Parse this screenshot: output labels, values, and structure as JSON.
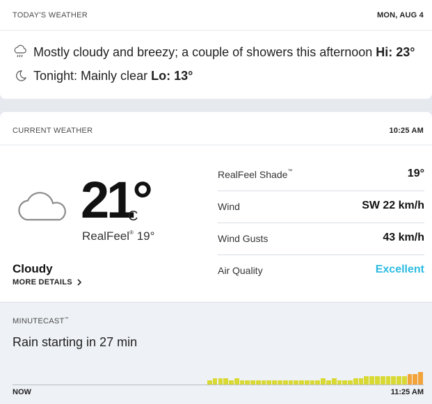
{
  "today": {
    "title": "TODAY'S WEATHER",
    "date": "MON, AUG 4",
    "day_phrase": "Mostly cloudy and breezy; a couple of showers this afternoon",
    "day_hi": "Hi: 23°",
    "night_phrase": "Tonight: Mainly clear",
    "night_lo": "Lo: 13°"
  },
  "current": {
    "title": "CURRENT WEATHER",
    "time": "10:25 AM",
    "temp": "21°",
    "unit": "C",
    "realfeel_label": "RealFeel",
    "realfeel_value": "19°",
    "phrase": "Cloudy",
    "more_details": "MORE DETAILS",
    "details": [
      {
        "label": "RealFeel Shade",
        "value": "19°"
      },
      {
        "label": "Wind",
        "value": "SW 22 km/h"
      },
      {
        "label": "Wind Gusts",
        "value": "43 km/h"
      },
      {
        "label": "Air Quality",
        "value": "Excellent"
      }
    ]
  },
  "minutecast": {
    "title": "MINUTECAST",
    "summary": "Rain starting in 27 min",
    "start_label": "NOW",
    "end_label": "11:25 AM",
    "intensity": [
      0,
      0,
      0,
      0,
      0,
      0,
      0,
      0,
      0,
      0,
      0,
      0,
      0,
      0,
      0,
      0,
      0,
      0,
      0,
      0,
      0,
      0,
      0,
      0,
      0,
      0,
      0,
      0,
      0,
      0,
      0,
      0,
      0,
      0,
      0,
      0,
      1,
      2,
      2,
      2,
      1,
      2,
      1,
      1,
      1,
      1,
      1,
      1,
      1,
      1,
      1,
      1,
      1,
      1,
      1,
      1,
      1,
      2,
      1,
      2,
      1,
      1,
      1,
      2,
      2,
      3,
      3,
      3,
      3,
      3,
      3,
      3,
      3,
      4,
      4,
      5
    ]
  },
  "colors": {
    "accent": "#2bbbe2",
    "bar_light": "#d9d936",
    "bar_heavy": "#f2a33a"
  },
  "icons": {
    "day": "cloud-rain-icon",
    "night": "moon-icon",
    "current": "cloud-icon",
    "more": "chevron-right-icon"
  }
}
